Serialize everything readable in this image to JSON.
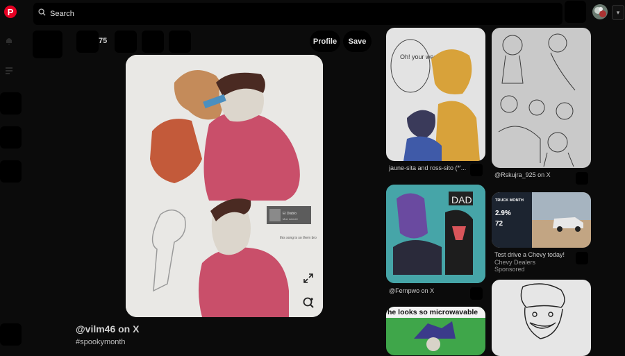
{
  "header": {
    "logo_letter": "P",
    "search_placeholder": "Search"
  },
  "toolbar": {
    "reaction_count": "75",
    "profile_label": "Profile",
    "save_label": "Save"
  },
  "pin": {
    "title": "@vilm46 on X",
    "tag": "#spookymonth",
    "watermark_title": "El Diablo",
    "watermark_sub": "Moe Lelechi",
    "handwriting": "this song is so them bro",
    "speech": "Oh! your wee so spooky"
  },
  "feed": {
    "col1": [
      {
        "caption": "jaune-sita and ross-sito (*'..."
      },
      {
        "caption": "@Fernpwo on X",
        "art_text": "DAD"
      },
      {
        "banner_text": "he looks so microwavable"
      }
    ],
    "col2": [
      {
        "caption": "@Rskujra_925 on X"
      },
      {
        "ad_title": "Test drive a Chevy today!",
        "ad_brand": "Chevy Dealers",
        "ad_label": "Sponsored",
        "ad_headline": "TRUCK MONTH",
        "ad_rate": "2.9%",
        "ad_months": "72"
      },
      {}
    ]
  },
  "colors": {
    "brand": "#e60023",
    "background": "#0b0b0b"
  }
}
